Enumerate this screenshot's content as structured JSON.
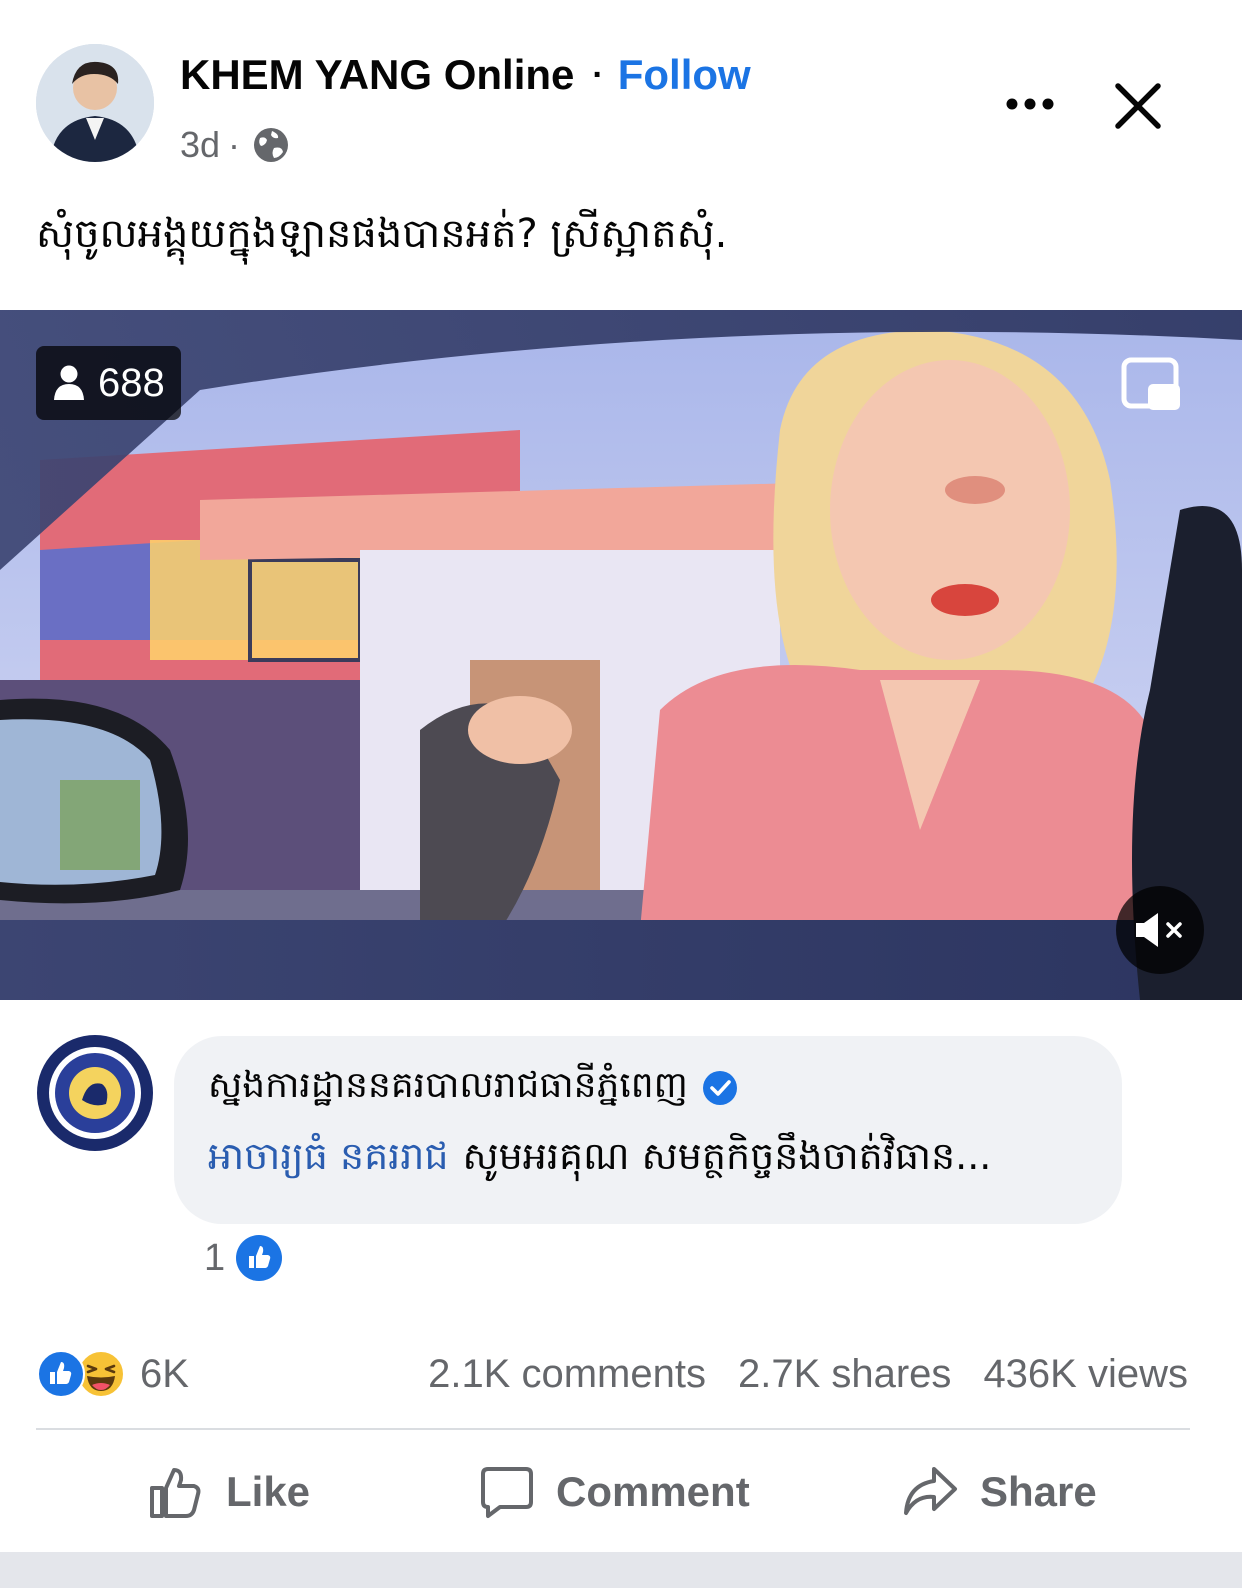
{
  "post": {
    "author": "KHEM YANG Online",
    "separator": "·",
    "follow_label": "Follow",
    "time": "3d",
    "meta_separator": "·",
    "privacy_icon": "globe-icon",
    "caption": "សុំចូលអង្គុយក្នុងឡានផងបានអត់? ស្រីស្អាតសុំ."
  },
  "header": {
    "more_icon": "more-icon",
    "close_icon": "close-icon"
  },
  "video": {
    "viewer_count": "688",
    "viewer_icon": "person-icon",
    "pip_icon": "picture-in-picture-icon",
    "mute_icon": "speaker-muted-icon"
  },
  "comment": {
    "author": "ស្នងការដ្ឋាននគរបាលរាជធានីភ្នំពេញ",
    "verified_icon": "verified-badge-icon",
    "mention": "អាចារ្យធំ នគររាជ",
    "text": "សូមអរគុណ សមត្ថកិច្ចនឹងចាត់វិធាន...",
    "like_count": "1",
    "like_icon": "like-reaction-icon"
  },
  "stats": {
    "reaction_icons": [
      "like-reaction-icon",
      "haha-reaction-icon"
    ],
    "reactions": "6K",
    "comments": "2.1K comments",
    "shares": "2.7K shares",
    "views": "436K views"
  },
  "actions": {
    "like_label": "Like",
    "comment_label": "Comment",
    "share_label": "Share"
  },
  "colors": {
    "accent": "#1b74e4",
    "secondary_text": "#65676b",
    "bubble_bg": "#f0f2f5",
    "mention": "#2a5db0"
  }
}
